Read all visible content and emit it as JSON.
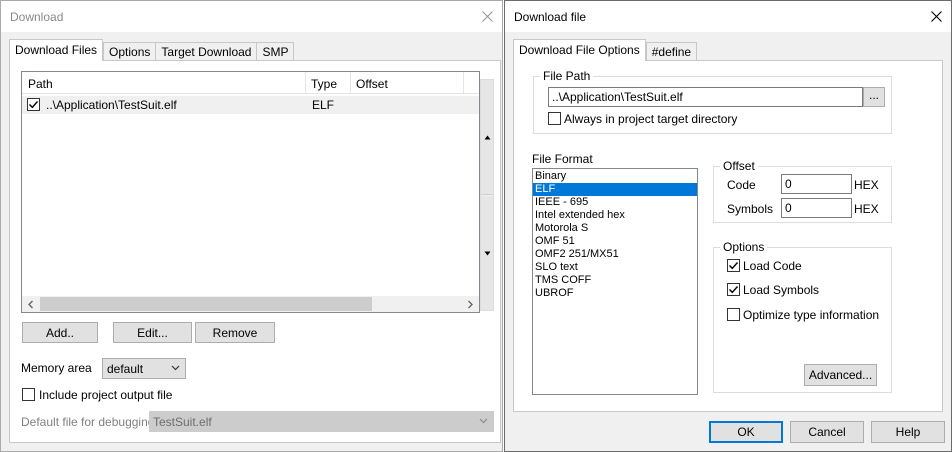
{
  "download": {
    "title": "Download",
    "tabs": [
      "Download Files",
      "Options",
      "Target Download",
      "SMP"
    ],
    "columns": [
      "Path",
      "Type",
      "Offset"
    ],
    "rows": [
      {
        "path": "..\\Application\\TestSuit.elf",
        "type": "ELF",
        "offset": "",
        "checked": true
      }
    ],
    "buttons": {
      "add": "Add..",
      "edit": "Edit...",
      "remove": "Remove"
    },
    "memory_area_label": "Memory area",
    "memory_area_value": "default",
    "include_output_label": "Include project output file",
    "default_file_label": "Default file for debugging",
    "default_file_value": "TestSuit.elf"
  },
  "download_file": {
    "title": "Download file",
    "tabs": [
      "Download File Options",
      "#define"
    ],
    "file_path_group": "File Path",
    "file_path_value": "..\\Application\\TestSuit.elf",
    "browse_label": "...",
    "always_in_target_label": "Always in project target directory",
    "file_format_label": "File Format",
    "formats": [
      "Binary",
      "ELF",
      "IEEE - 695",
      "Intel extended hex",
      "Motorola S",
      "OMF 51",
      "OMF2 251/MX51",
      "SLO text",
      "TMS COFF",
      "UBROF"
    ],
    "selected_format": "ELF",
    "offset_group": "Offset",
    "code_label": "Code",
    "code_value": "0",
    "symbols_label": "Symbols",
    "symbols_value": "0",
    "hex_label": "HEX",
    "options_group": "Options",
    "load_code_label": "Load Code",
    "load_symbols_label": "Load Symbols",
    "optimize_label": "Optimize type information",
    "advanced_label": "Advanced...",
    "ok_label": "OK",
    "cancel_label": "Cancel",
    "help_label": "Help"
  }
}
